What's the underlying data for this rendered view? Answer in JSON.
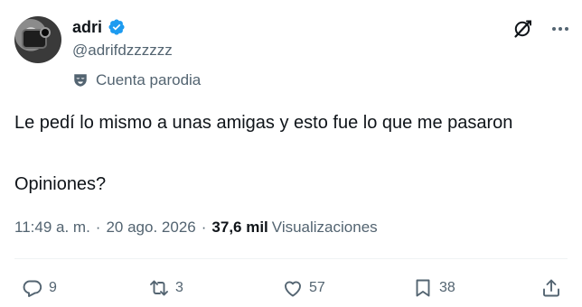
{
  "author": {
    "display_name": "adri",
    "handle": "@adrifdzzzzzz",
    "parody_label": "Cuenta parodia",
    "verified": true
  },
  "colors": {
    "verified_blue": "#1d9bf0",
    "text_primary": "#0f1419",
    "text_secondary": "#536471"
  },
  "tweet": {
    "line1": "Le pedí lo mismo a unas amigas y esto fue lo que me pasaron",
    "line2": "Opiniones?"
  },
  "meta": {
    "time": "11:49 a. m.",
    "separator": "·",
    "date": "20 ago. 2026",
    "views_count": "37,6 mil",
    "views_label": "Visualizaciones"
  },
  "actions": {
    "replies": "9",
    "retweets": "3",
    "likes": "57",
    "bookmarks": "38"
  },
  "icons": {
    "top": [
      "grok-icon",
      "more-icon"
    ],
    "bar": [
      "reply-icon",
      "retweet-icon",
      "like-icon",
      "bookmark-icon",
      "share-icon"
    ]
  }
}
